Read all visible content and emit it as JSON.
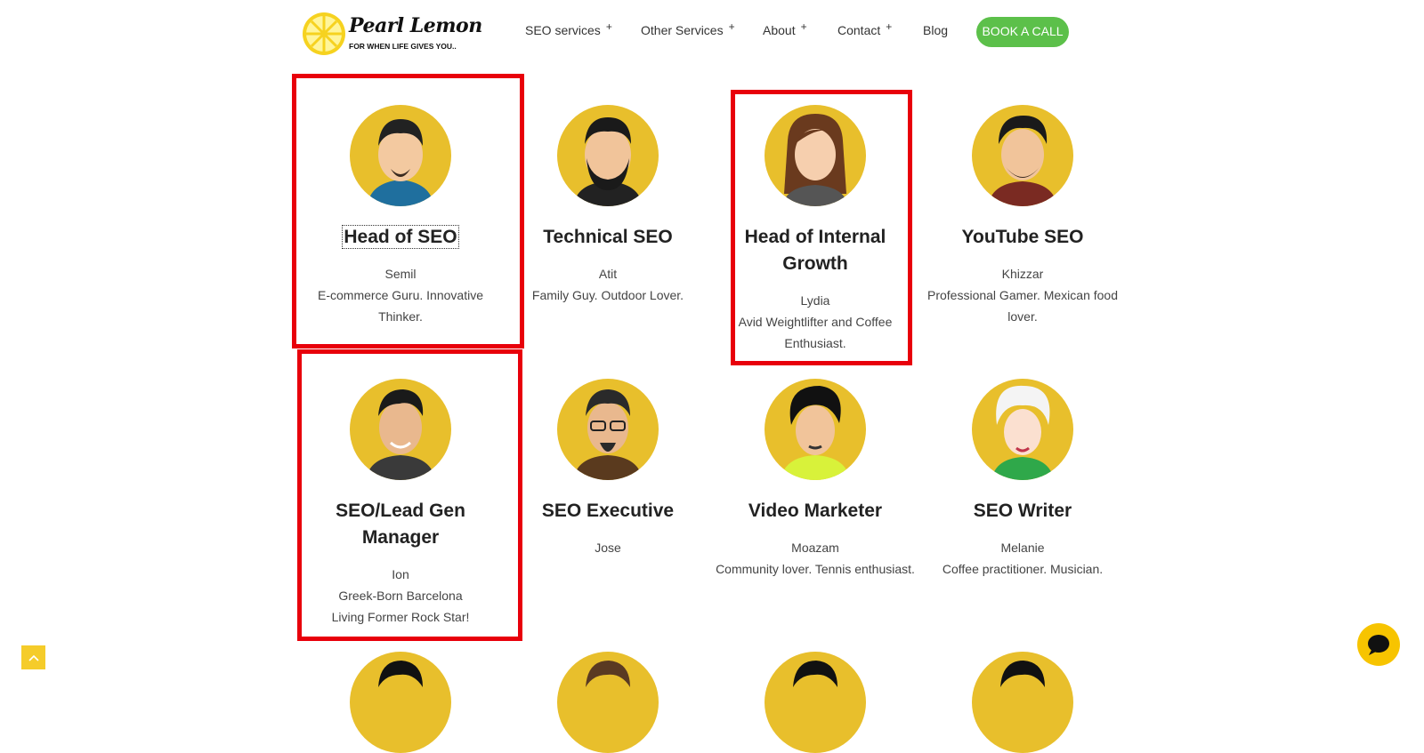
{
  "brand": {
    "name": "Pearl Lemon",
    "tagline": "FOR WHEN LIFE GIVES YOU.."
  },
  "nav": {
    "items": [
      {
        "label": "SEO services",
        "has_sub": "+"
      },
      {
        "label": "Other Services",
        "has_sub": "+"
      },
      {
        "label": "About",
        "has_sub": "+"
      },
      {
        "label": "Contact",
        "has_sub": "+"
      },
      {
        "label": "Blog"
      }
    ],
    "cta": "BOOK A CALL"
  },
  "team": [
    {
      "role": "Head of SEO",
      "name": "Semil",
      "desc": "E-commerce Guru. Innovative Thinker."
    },
    {
      "role": "Technical SEO",
      "name": "Atit",
      "desc": "Family Guy. Outdoor Lover."
    },
    {
      "role": "Head of Internal Growth",
      "name": "Lydia",
      "desc": "Avid Weightlifter and Coffee Enthusiast."
    },
    {
      "role": "YouTube SEO",
      "name": "Khizzar",
      "desc": "Professional Gamer. Mexican food lover."
    },
    {
      "role": "SEO/Lead Gen Manager",
      "name": "Ion",
      "desc": "Greek-Born Barcelona Living Former Rock Star!"
    },
    {
      "role": "SEO Executive",
      "name": "Jose",
      "desc": ""
    },
    {
      "role": "Video Marketer",
      "name": "Moazam",
      "desc": "Community lover. Tennis enthusiast."
    },
    {
      "role": "SEO Writer",
      "name": "Melanie",
      "desc": "Coffee practitioner. Musician."
    }
  ],
  "colors": {
    "accent_yellow": "#e8bf2c",
    "cta_green": "#5cc04a",
    "highlight_red": "#e8000b"
  },
  "icons": {
    "scroll_top": "chevron-up-icon",
    "chat": "chat-bubble-icon"
  }
}
